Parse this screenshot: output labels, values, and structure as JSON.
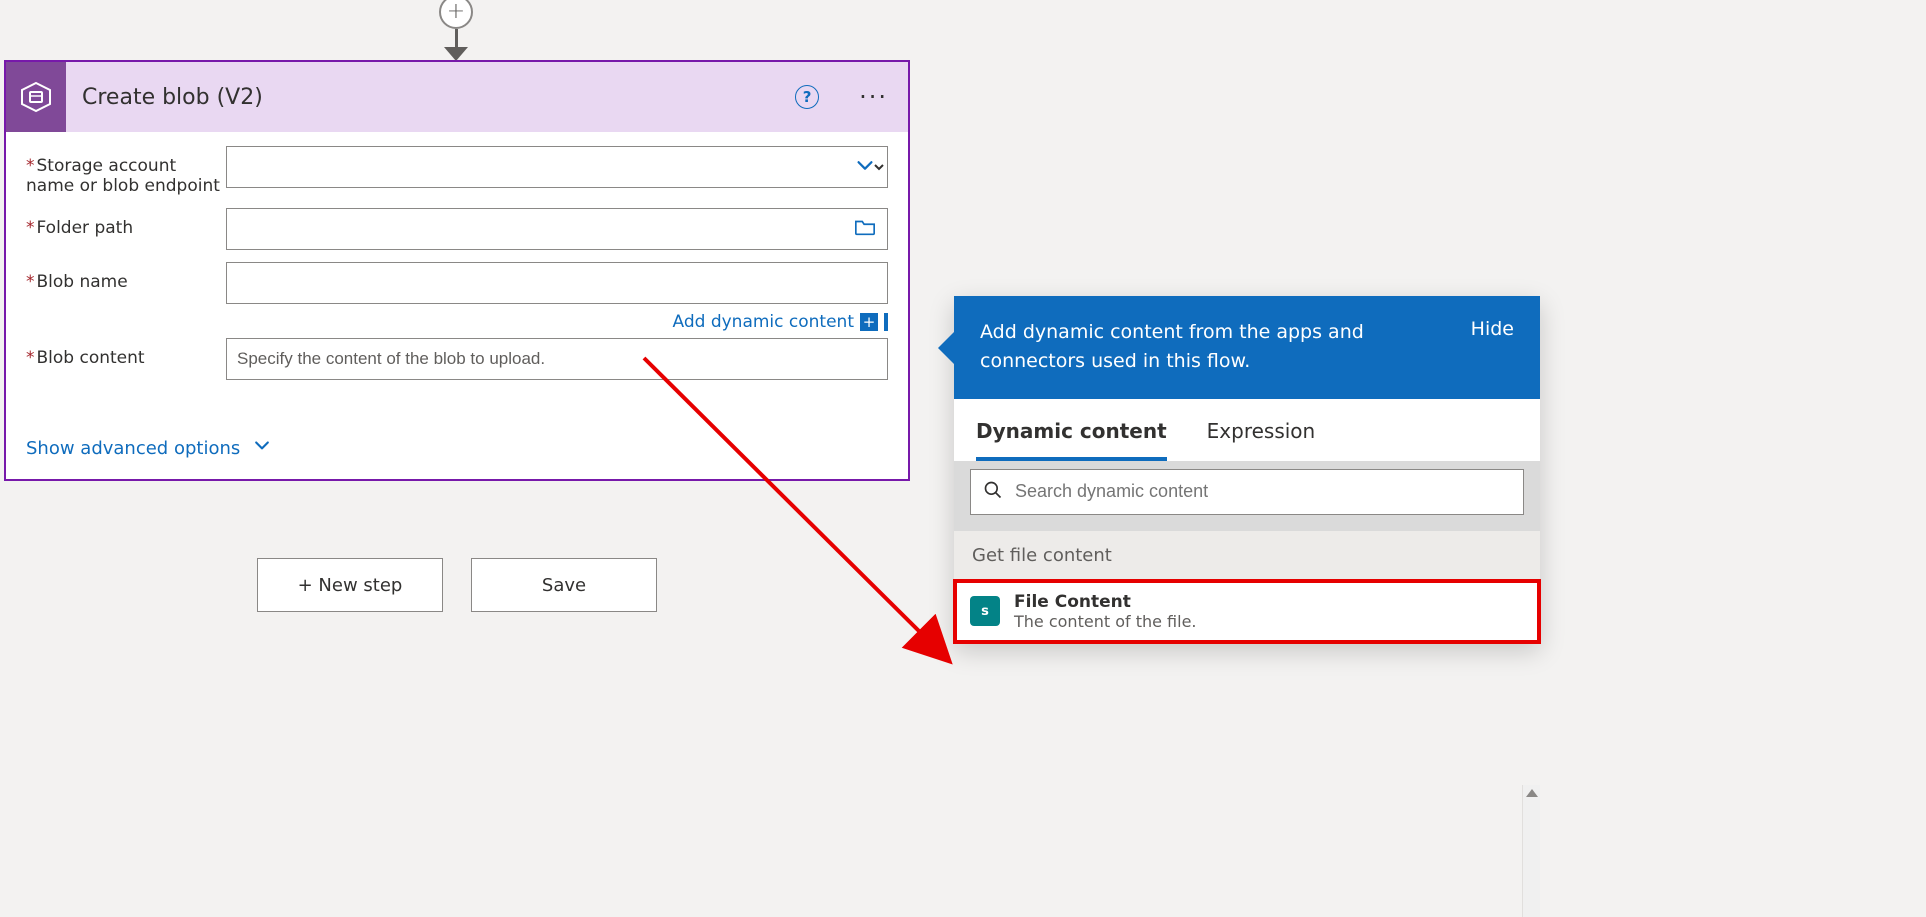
{
  "card": {
    "title": "Create blob (V2)",
    "fields": {
      "storage_label": "Storage account name or blob endpoint",
      "folder_label": "Folder path",
      "blobname_label": "Blob name",
      "blobcontent_label": "Blob content",
      "blobcontent_placeholder": "Specify the content of the blob to upload."
    },
    "dyn_link": "Add dynamic content",
    "advanced_label": "Show advanced options"
  },
  "buttons": {
    "new_step": "+ New step",
    "save": "Save"
  },
  "dyn_panel": {
    "message": "Add dynamic content from the apps and connectors used in this flow.",
    "hide": "Hide",
    "tab_dynamic": "Dynamic content",
    "tab_expression": "Expression",
    "search_placeholder": "Search dynamic content",
    "group_title": "Get file content",
    "item": {
      "name": "File Content",
      "desc": "The content of the file."
    }
  },
  "icons": {
    "sp_text": "s"
  }
}
